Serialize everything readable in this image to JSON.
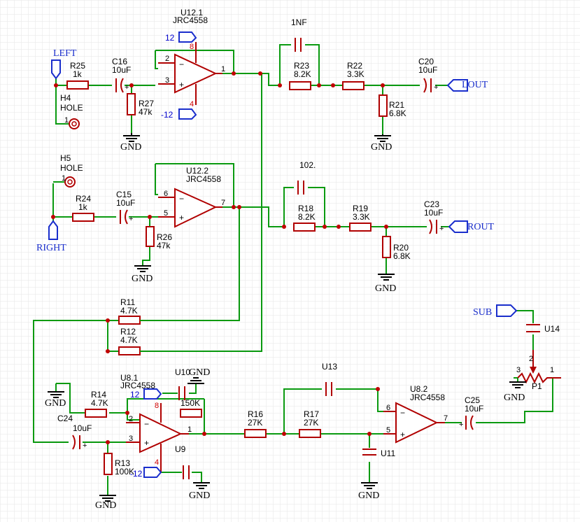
{
  "nets": {
    "left": "LEFT",
    "right": "RIGHT",
    "lout": "LOUT",
    "rout": "ROUT",
    "sub": "SUB"
  },
  "gnd": "GND",
  "power": {
    "pos": "12",
    "neg": "-12"
  },
  "u12_1": {
    "ref": "U12.1",
    "part": "JRC4558",
    "pin8": "8",
    "pin4": "4",
    "pin2": "2",
    "pin3": "3",
    "pin1": "1"
  },
  "u12_2": {
    "ref": "U12.2",
    "part": "JRC4558",
    "pin6": "6",
    "pin5": "5",
    "pin7": "7"
  },
  "u8_1": {
    "ref": "U8.1",
    "part": "JRC4558",
    "pin8": "8",
    "pin4": "4",
    "pin2": "2",
    "pin3": "3",
    "pin1": "1",
    "label": "U9"
  },
  "u8_2": {
    "ref": "U8.2",
    "part": "JRC4558",
    "pin6": "6",
    "pin5": "5",
    "pin7": "7"
  },
  "h4": {
    "ref": "H4",
    "val": "HOLE",
    "pin": "1"
  },
  "h5": {
    "ref": "H5",
    "val": "HOLE",
    "pin": "1"
  },
  "r25": {
    "ref": "R25",
    "val": "1k"
  },
  "r27": {
    "ref": "R27",
    "val": "47k"
  },
  "r24": {
    "ref": "R24",
    "val": "1k"
  },
  "r26": {
    "ref": "R26",
    "val": "47k"
  },
  "r23": {
    "ref": "R23",
    "val": "8.2K"
  },
  "r22": {
    "ref": "R22",
    "val": "3.3K"
  },
  "r21": {
    "ref": "R21",
    "val": "6.8K"
  },
  "r18": {
    "ref": "R18",
    "val": "8.2K"
  },
  "r19": {
    "ref": "R19",
    "val": "3.3K"
  },
  "r20": {
    "ref": "R20",
    "val": "6.8K"
  },
  "r11": {
    "ref": "R11",
    "val": "4.7K"
  },
  "r12": {
    "ref": "R12",
    "val": "4.7K"
  },
  "r14": {
    "ref": "R14",
    "val": "4.7K"
  },
  "r13": {
    "ref": "R13",
    "val": "100K"
  },
  "r16": {
    "ref": "R16",
    "val": "27K"
  },
  "r17": {
    "ref": "R17",
    "val": "27K"
  },
  "r150": {
    "val": "150K"
  },
  "c16": {
    "ref": "C16",
    "val": "10uF"
  },
  "c15": {
    "ref": "C15",
    "val": "10uF"
  },
  "c20": {
    "ref": "C20",
    "val": "10uF"
  },
  "c23": {
    "ref": "C23",
    "val": "10uF"
  },
  "c24": {
    "ref": "C24",
    "val": "10uF"
  },
  "c25": {
    "ref": "C25",
    "val": "10uF"
  },
  "c_1nf": {
    "val": "1NF"
  },
  "c_102": {
    "val": "102."
  },
  "u10": {
    "ref": "U10"
  },
  "u11": {
    "ref": "U11"
  },
  "u13": {
    "ref": "U13"
  },
  "u14": {
    "ref": "U14"
  },
  "p1": {
    "ref": "P1",
    "pin1": "1",
    "pin2": "2",
    "pin3": "3"
  }
}
